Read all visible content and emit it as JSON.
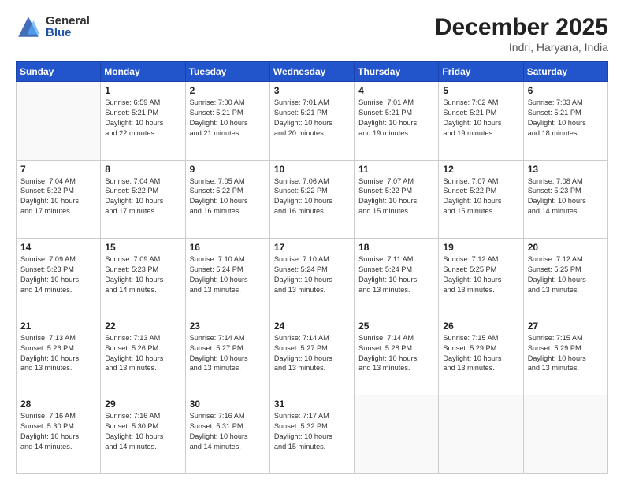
{
  "logo": {
    "general": "General",
    "blue": "Blue"
  },
  "header": {
    "month": "December 2025",
    "location": "Indri, Haryana, India"
  },
  "weekdays": [
    "Sunday",
    "Monday",
    "Tuesday",
    "Wednesday",
    "Thursday",
    "Friday",
    "Saturday"
  ],
  "weeks": [
    [
      {
        "day": "",
        "info": ""
      },
      {
        "day": "1",
        "info": "Sunrise: 6:59 AM\nSunset: 5:21 PM\nDaylight: 10 hours\nand 22 minutes."
      },
      {
        "day": "2",
        "info": "Sunrise: 7:00 AM\nSunset: 5:21 PM\nDaylight: 10 hours\nand 21 minutes."
      },
      {
        "day": "3",
        "info": "Sunrise: 7:01 AM\nSunset: 5:21 PM\nDaylight: 10 hours\nand 20 minutes."
      },
      {
        "day": "4",
        "info": "Sunrise: 7:01 AM\nSunset: 5:21 PM\nDaylight: 10 hours\nand 19 minutes."
      },
      {
        "day": "5",
        "info": "Sunrise: 7:02 AM\nSunset: 5:21 PM\nDaylight: 10 hours\nand 19 minutes."
      },
      {
        "day": "6",
        "info": "Sunrise: 7:03 AM\nSunset: 5:21 PM\nDaylight: 10 hours\nand 18 minutes."
      }
    ],
    [
      {
        "day": "7",
        "info": "Sunrise: 7:04 AM\nSunset: 5:22 PM\nDaylight: 10 hours\nand 17 minutes."
      },
      {
        "day": "8",
        "info": "Sunrise: 7:04 AM\nSunset: 5:22 PM\nDaylight: 10 hours\nand 17 minutes."
      },
      {
        "day": "9",
        "info": "Sunrise: 7:05 AM\nSunset: 5:22 PM\nDaylight: 10 hours\nand 16 minutes."
      },
      {
        "day": "10",
        "info": "Sunrise: 7:06 AM\nSunset: 5:22 PM\nDaylight: 10 hours\nand 16 minutes."
      },
      {
        "day": "11",
        "info": "Sunrise: 7:07 AM\nSunset: 5:22 PM\nDaylight: 10 hours\nand 15 minutes."
      },
      {
        "day": "12",
        "info": "Sunrise: 7:07 AM\nSunset: 5:22 PM\nDaylight: 10 hours\nand 15 minutes."
      },
      {
        "day": "13",
        "info": "Sunrise: 7:08 AM\nSunset: 5:23 PM\nDaylight: 10 hours\nand 14 minutes."
      }
    ],
    [
      {
        "day": "14",
        "info": "Sunrise: 7:09 AM\nSunset: 5:23 PM\nDaylight: 10 hours\nand 14 minutes."
      },
      {
        "day": "15",
        "info": "Sunrise: 7:09 AM\nSunset: 5:23 PM\nDaylight: 10 hours\nand 14 minutes."
      },
      {
        "day": "16",
        "info": "Sunrise: 7:10 AM\nSunset: 5:24 PM\nDaylight: 10 hours\nand 13 minutes."
      },
      {
        "day": "17",
        "info": "Sunrise: 7:10 AM\nSunset: 5:24 PM\nDaylight: 10 hours\nand 13 minutes."
      },
      {
        "day": "18",
        "info": "Sunrise: 7:11 AM\nSunset: 5:24 PM\nDaylight: 10 hours\nand 13 minutes."
      },
      {
        "day": "19",
        "info": "Sunrise: 7:12 AM\nSunset: 5:25 PM\nDaylight: 10 hours\nand 13 minutes."
      },
      {
        "day": "20",
        "info": "Sunrise: 7:12 AM\nSunset: 5:25 PM\nDaylight: 10 hours\nand 13 minutes."
      }
    ],
    [
      {
        "day": "21",
        "info": "Sunrise: 7:13 AM\nSunset: 5:26 PM\nDaylight: 10 hours\nand 13 minutes."
      },
      {
        "day": "22",
        "info": "Sunrise: 7:13 AM\nSunset: 5:26 PM\nDaylight: 10 hours\nand 13 minutes."
      },
      {
        "day": "23",
        "info": "Sunrise: 7:14 AM\nSunset: 5:27 PM\nDaylight: 10 hours\nand 13 minutes."
      },
      {
        "day": "24",
        "info": "Sunrise: 7:14 AM\nSunset: 5:27 PM\nDaylight: 10 hours\nand 13 minutes."
      },
      {
        "day": "25",
        "info": "Sunrise: 7:14 AM\nSunset: 5:28 PM\nDaylight: 10 hours\nand 13 minutes."
      },
      {
        "day": "26",
        "info": "Sunrise: 7:15 AM\nSunset: 5:29 PM\nDaylight: 10 hours\nand 13 minutes."
      },
      {
        "day": "27",
        "info": "Sunrise: 7:15 AM\nSunset: 5:29 PM\nDaylight: 10 hours\nand 13 minutes."
      }
    ],
    [
      {
        "day": "28",
        "info": "Sunrise: 7:16 AM\nSunset: 5:30 PM\nDaylight: 10 hours\nand 14 minutes."
      },
      {
        "day": "29",
        "info": "Sunrise: 7:16 AM\nSunset: 5:30 PM\nDaylight: 10 hours\nand 14 minutes."
      },
      {
        "day": "30",
        "info": "Sunrise: 7:16 AM\nSunset: 5:31 PM\nDaylight: 10 hours\nand 14 minutes."
      },
      {
        "day": "31",
        "info": "Sunrise: 7:17 AM\nSunset: 5:32 PM\nDaylight: 10 hours\nand 15 minutes."
      },
      {
        "day": "",
        "info": ""
      },
      {
        "day": "",
        "info": ""
      },
      {
        "day": "",
        "info": ""
      }
    ]
  ]
}
